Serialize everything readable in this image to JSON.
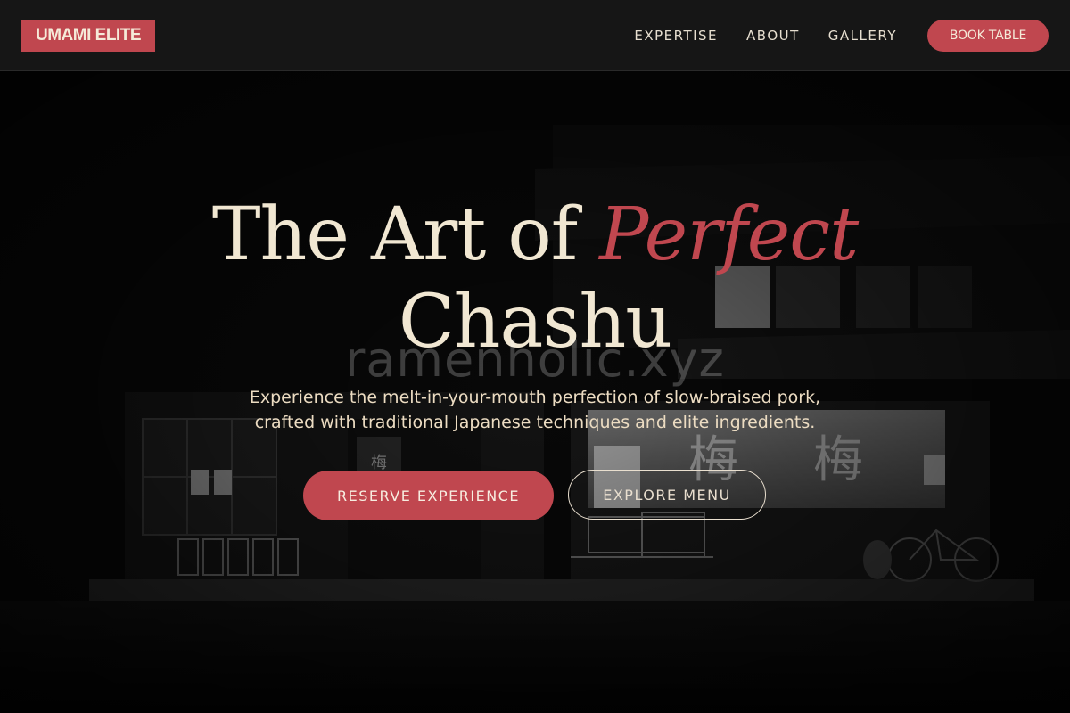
{
  "header": {
    "logo": "UMAMI ELITE",
    "nav": [
      "EXPERTISE",
      "ABOUT",
      "GALLERY"
    ],
    "cta": "BOOK TABLE"
  },
  "hero": {
    "title_line1_a": "The Art of ",
    "title_line1_accent": "Perfect",
    "title_line2": "Chashu",
    "watermark": "ramenholic.xyz",
    "subtitle_line1": "Experience the melt-in-your-mouth perfection of slow-braised pork,",
    "subtitle_line2": "crafted with traditional Japanese techniques and elite ingredients.",
    "primary_button": "RESERVE EXPERIENCE",
    "secondary_button": "EXPLORE MENU",
    "sign_chars": [
      "梅",
      "梅"
    ]
  },
  "colors": {
    "accent": "#c0474f",
    "cream": "#f1e7d2",
    "header_bg": "#161616"
  }
}
